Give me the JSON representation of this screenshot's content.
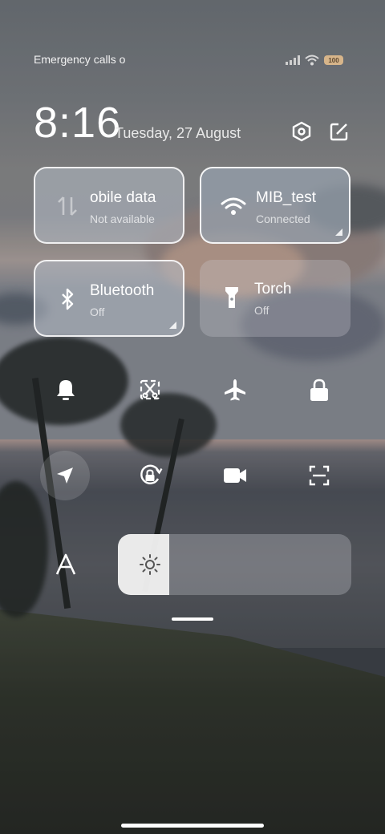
{
  "status_bar": {
    "carrier_text": "Emergency calls o",
    "battery": "100"
  },
  "header": {
    "time": "8:16",
    "date": "Tuesday, 27 August",
    "settings_icon": "hexagon-settings-icon",
    "edit_icon": "edit-icon"
  },
  "tiles": {
    "mobile_data": {
      "title": "obile data",
      "status": "Not available",
      "icon": "data-arrows-icon"
    },
    "wifi": {
      "title": "MIB_test",
      "status": "Connected",
      "icon": "wifi-icon"
    },
    "bluetooth": {
      "title": "Bluetooth",
      "status": "Off",
      "icon": "bluetooth-icon"
    },
    "torch": {
      "title": "Torch",
      "status": "Off",
      "icon": "torch-icon"
    }
  },
  "quick_icons": [
    "bell-icon",
    "screenshot-icon",
    "airplane-icon",
    "lock-icon",
    "location-icon",
    "rotation-lock-icon",
    "video-icon",
    "scan-icon"
  ],
  "brightness": {
    "level": 0.22,
    "icon": "sun-icon",
    "auto_icon": "font-size-icon"
  },
  "colors": {
    "tile_on": "#c8cdd4",
    "accent": "#ffffff",
    "battery": "#d7b58a"
  }
}
